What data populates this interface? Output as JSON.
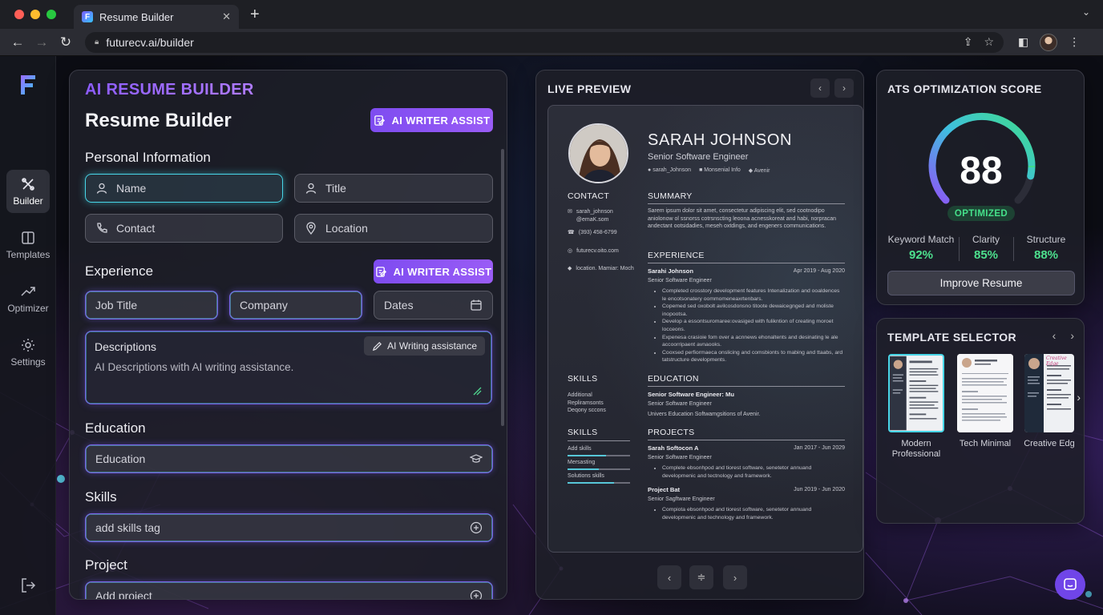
{
  "browser": {
    "tab_title": "Resume Builder",
    "url": "futurecv.ai/builder"
  },
  "sidebar": {
    "items": [
      {
        "label": "Builder",
        "icon": "builder-icon",
        "active": true
      },
      {
        "label": "Templates",
        "icon": "templates-icon",
        "active": false
      },
      {
        "label": "Optimizer",
        "icon": "optimizer-icon",
        "active": false
      },
      {
        "label": "Settings",
        "icon": "gear-icon",
        "active": false
      }
    ]
  },
  "builder": {
    "kicker": "AI RESUME BUILDER",
    "title": "Resume Builder",
    "ai_writer_label": "AI WRITER ASSIST",
    "personal": {
      "heading": "Personal Information",
      "name": "Name",
      "title": "Title",
      "contact": "Contact",
      "location": "Location"
    },
    "experience": {
      "heading": "Experience",
      "ai_writer_label": "AI WRITER ASSIST",
      "job_title": "Job Title",
      "company": "Company",
      "dates": "Dates",
      "desc_label": "Descriptions",
      "desc_chip": "AI Writing assistance",
      "desc_placeholder": "AI Descriptions with AI writing assistance."
    },
    "education": {
      "heading": "Education",
      "placeholder": "Education"
    },
    "skills": {
      "heading": "Skills",
      "placeholder": "add skills tag"
    },
    "project": {
      "heading": "Project",
      "placeholder": "Add project"
    }
  },
  "preview": {
    "heading": "LIVE PREVIEW",
    "resume": {
      "name": "SARAH JOHNSON",
      "role": "Senior Software Engineer",
      "meta": [
        "sarah_Johnson",
        "Monsenial Info",
        "Avenir"
      ],
      "contact_heading": "CONTACT",
      "contact_items": [
        "sarah_johnson @emaK.som",
        "(393) 458-6799",
        "futurecv.oito.com",
        "location. Mamiar: Moch"
      ],
      "summary_heading": "SUMMARY",
      "summary_text": "Sarem ipsum dolor sit amet, consectetur adipiscing elit, sed cootnodipo aniolonow ol ssnorss cotrsnscting leoona acnesskoreat and habi, norpracan andectant ootsidadies, meseh oxtdings, and engeners communications.",
      "experience_heading": "EXPERIENCE",
      "exp_title": "Sarahi Johnson",
      "exp_dates": "Apr 2019 - Aug 2020",
      "exp_role": "Senior Software Engineer",
      "exp_bullets": [
        "Completed crosstory development features Intenalization and ooaldences le encotsonatery oommomeneaxrtenbars.",
        "Copemed sed oxobolt avilcosdonsno titoote dewaicegnged and moliste inopootsa.",
        "Develop a essontsuromaree:ovasiged with fulikntion of creating moroet locceons.",
        "Expenesa crasioie fom over a acnnews ehonaltents and desinating le ale accoorripaent avnaooks.",
        "Cooxsed perfiormaeca onslicing and comsbionts to mabing and ttaabs, ard tatstructure developments."
      ],
      "skills_heading": "SKILLS",
      "skills_text": [
        "Additional",
        "Repliramsonts",
        "Deqony sccons"
      ],
      "education_heading": "EDUCATION",
      "edu_title": "Senior Software Engineer: Mu",
      "edu_role": "Senior Software Engineer",
      "edu_line": "Univers Education Softwamgsitions of Avenir.",
      "skills2_heading": "SKILLS",
      "skills2_items": [
        "Add skills",
        "Mersasting",
        "Solutions skills"
      ],
      "skill_levels": [
        0.62,
        0.5,
        0.74
      ],
      "projects_heading": "PROJECTS",
      "proj1_title": "Sarah Softocon A",
      "proj1_dates": "Jan 2017 - Jun 2029",
      "proj1_role": "Senior Software Engineer",
      "proj1_bullet": "Complete ebsonhpod and tiorest software, senetetor annuand developmenic and tectnology and framework.",
      "proj2_title": "Project Bat",
      "proj2_dates": "Jun 2019 - Jun 2020",
      "proj2_role": "Senior Sagftware Engineer",
      "proj2_bullet": "Compiota ebsonhpod and tiorest software, senetetor annuand developmenic and technology and framework."
    }
  },
  "ats": {
    "heading": "ATS OPTIMIZATION SCORE",
    "score": "88",
    "score_fraction": 0.88,
    "badge": "OPTIMIZED",
    "metrics": [
      {
        "label": "Keyword Match",
        "value": "92%"
      },
      {
        "label": "Clarity",
        "value": "85%"
      },
      {
        "label": "Structure",
        "value": "88%"
      }
    ],
    "improve_label": "Improve Resume"
  },
  "templates": {
    "heading": "TEMPLATE SELECTOR",
    "items": [
      {
        "label": "Modern Professional",
        "selected": true
      },
      {
        "label": "Tech Minimal",
        "selected": false
      },
      {
        "label": "Creative Edg",
        "selected": false
      }
    ],
    "creative_thumb_title": "Creative Edge"
  },
  "colors": {
    "accent": "#8d5cff",
    "cyan": "#48d6e8",
    "success": "#45e08a"
  }
}
